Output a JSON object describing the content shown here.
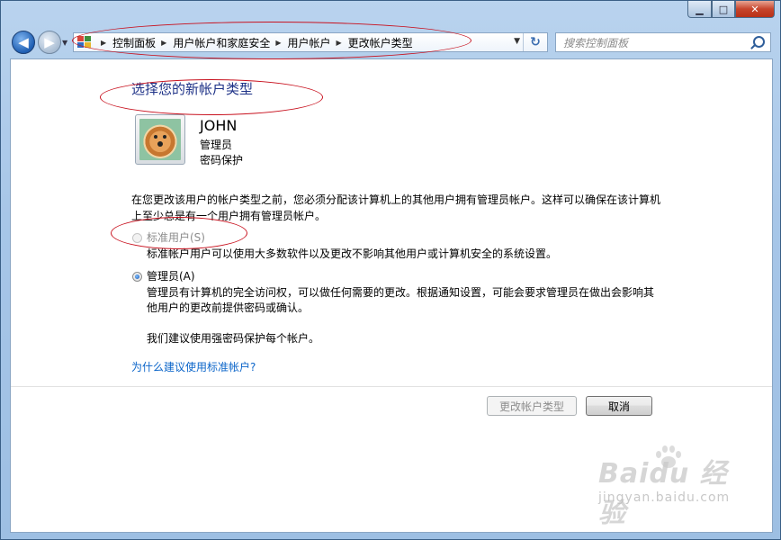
{
  "titlebar": {
    "minimize_glyph": "▁",
    "maximize_glyph": "□",
    "close_glyph": "✕"
  },
  "nav": {
    "back_glyph": "◀",
    "forward_glyph": "▶",
    "breadcrumbs": [
      "控制面板",
      "用户帐户和家庭安全",
      "用户帐户",
      "更改帐户类型"
    ],
    "search_placeholder": "搜索控制面板"
  },
  "page": {
    "title": "选择您的新帐户类型",
    "user": {
      "name": "JOHN",
      "role": "管理员",
      "protection": "密码保护"
    },
    "description": "在您更改该用户的帐户类型之前，您必须分配该计算机上的其他用户拥有管理员帐户。这样可以确保在该计算机上至少总是有一个用户拥有管理员帐户。",
    "options": [
      {
        "label": "标准用户(S)",
        "description": "标准帐户用户可以使用大多数软件以及更改不影响其他用户或计算机安全的系统设置。",
        "selected": false,
        "enabled": false
      },
      {
        "label": "管理员(A)",
        "description": "管理员有计算机的完全访问权，可以做任何需要的更改。根据通知设置，可能会要求管理员在做出会影响其他用户的更改前提供密码或确认。",
        "note": "我们建议使用强密码保护每个帐户。",
        "selected": true,
        "enabled": true
      }
    ],
    "help_link": "为什么建议使用标准帐户?",
    "buttons": {
      "change": "更改帐户类型",
      "cancel": "取消"
    }
  },
  "watermark": {
    "brand": "Baidu 经验",
    "url": "jingyan.baidu.com"
  },
  "colors": {
    "title": "#1e3287",
    "link": "#0b65c9",
    "annotation": "#c8121f"
  }
}
